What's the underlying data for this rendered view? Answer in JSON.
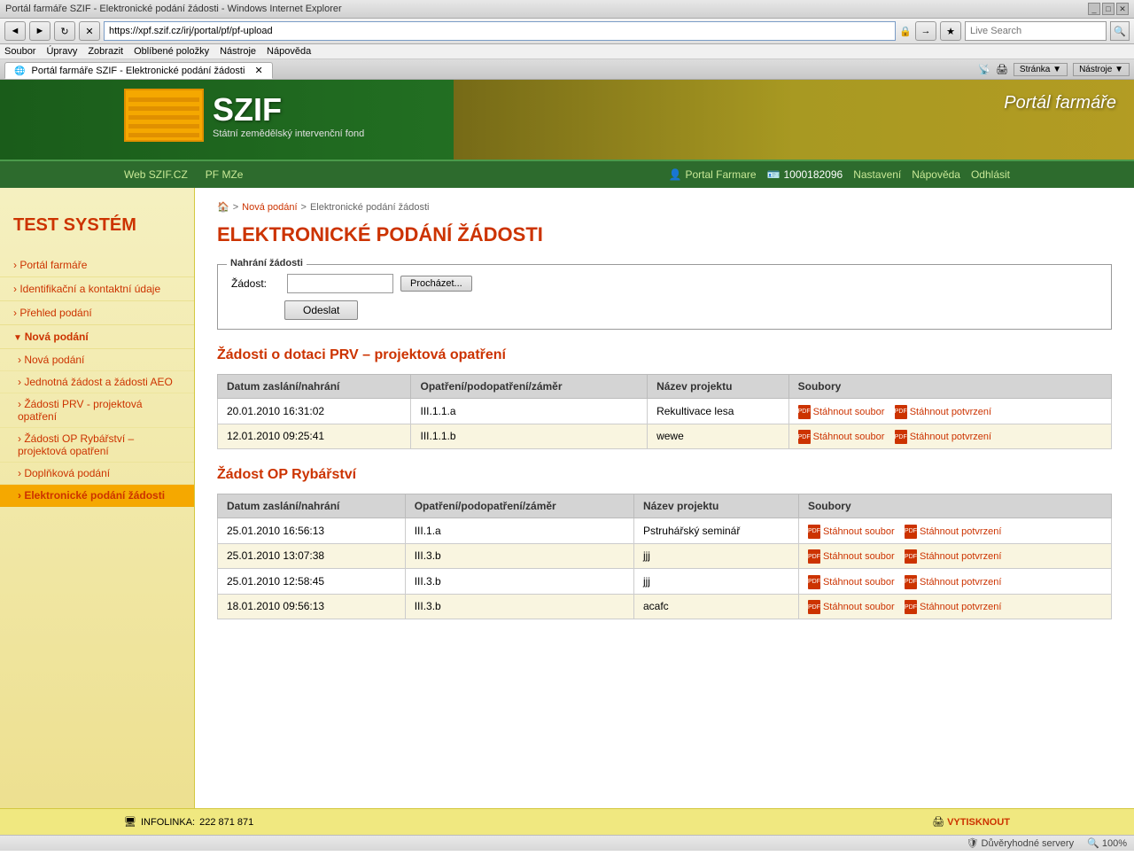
{
  "browser": {
    "title": "Portál farmáře SZIF - Elektronické podání žádosti - Windows Internet Explorer",
    "address": "https://xpf.szif.cz/irj/portal/pf/pf-upload",
    "search_placeholder": "Live Search",
    "tab_label": "Portál farmáře SZIF - Elektronické podání žádosti",
    "search_label": "Search",
    "nav_back": "◄",
    "nav_forward": "►",
    "nav_refresh": "↻",
    "nav_stop": "✕",
    "menu": {
      "soubor": "Soubor",
      "upravy": "Úpravy",
      "zobrazit": "Zobrazit",
      "oblibene": "Oblíbené položky",
      "nastroje": "Nástroje",
      "napoveda": "Nápověda"
    },
    "secondary_toolbar": {
      "stranka": "Stránka",
      "nastroje": "Nástroje"
    },
    "statusbar": {
      "status": "Důvěryhodné servery",
      "zoom": "100%"
    }
  },
  "header": {
    "logo_text": "SZIF",
    "subtitle": "Státní zemědělský intervenční fond",
    "portal_label": "Portál farmáře",
    "nav": {
      "web_szif": "Web SZIF.CZ",
      "pf_mze": "PF MZe",
      "portal_farmare": "Portal Farmare",
      "user_id": "1000182096",
      "nastaveni": "Nastavení",
      "napoveda": "Nápověda",
      "odhlasit": "Odhlásit"
    }
  },
  "sidebar": {
    "title": "TEST SYSTÉM",
    "items": [
      {
        "label": "Portál farmáře",
        "id": "portal-farmare"
      },
      {
        "label": "Identifikační a kontaktní údaje",
        "id": "identifikacni"
      },
      {
        "label": "Přehled podání",
        "id": "prehled-podani"
      }
    ],
    "section": "Nová podání",
    "sub_items": [
      {
        "label": "Nová podání",
        "id": "nova-podani",
        "active": false
      },
      {
        "label": "Jednotná žádost a žádosti AEO",
        "id": "jednotna-zadost",
        "active": false
      },
      {
        "label": "Žádosti PRV - projektová opatření",
        "id": "zadosti-prv",
        "active": false
      },
      {
        "label": "Žádosti OP Rybářství – projektová opatření",
        "id": "zadosti-op",
        "active": false
      },
      {
        "label": "Doplňková podání",
        "id": "doplnkova-podani",
        "active": false
      },
      {
        "label": "Elektronické podání žádosti",
        "id": "elektronicke-podani",
        "active": true
      }
    ]
  },
  "breadcrumb": {
    "home_icon": "🏠",
    "nova_podani": "Nová podání",
    "current": "Elektronické podání žádosti"
  },
  "content": {
    "page_title": "ELEKTRONICKÉ PODÁNÍ ŽÁDOSTI",
    "upload": {
      "legend": "Nahrání žádosti",
      "label": "Žádost:",
      "browse_btn": "Procházet...",
      "submit_btn": "Odeslat"
    },
    "prv_section": {
      "heading": "Žádosti o dotaci PRV – projektová opatření",
      "columns": [
        "Datum zaslání/nahrání",
        "Opatření/podopatření/záměr",
        "Název projektu",
        "Soubory"
      ],
      "rows": [
        {
          "datum": "20.01.2010 16:31:02",
          "opatreni": "III.1.1.a",
          "projekt": "Rekultivace lesa",
          "soubor_link": "Stáhnout soubor",
          "potvrzeni_link": "Stáhnout potvrzení"
        },
        {
          "datum": "12.01.2010 09:25:41",
          "opatreni": "III.1.1.b",
          "projekt": "wewe",
          "soubor_link": "Stáhnout soubor",
          "potvrzeni_link": "Stáhnout potvrzení"
        }
      ]
    },
    "rybarstvi_section": {
      "heading": "Žádost OP Rybářství",
      "columns": [
        "Datum zaslání/nahrání",
        "Opatření/podopatření/záměr",
        "Název projektu",
        "Soubory"
      ],
      "rows": [
        {
          "datum": "25.01.2010 16:56:13",
          "opatreni": "III.1.a",
          "projekt": "Pstruhářský seminář",
          "soubor_link": "Stáhnout soubor",
          "potvrzeni_link": "Stáhnout potvrzení"
        },
        {
          "datum": "25.01.2010 13:07:38",
          "opatreni": "III.3.b",
          "projekt": "jjj",
          "soubor_link": "Stáhnout soubor",
          "potvrzeni_link": "Stáhnout potvrzení"
        },
        {
          "datum": "25.01.2010 12:58:45",
          "opatreni": "III.3.b",
          "projekt": "jjj",
          "soubor_link": "Stáhnout soubor",
          "potvrzeni_link": "Stáhnout potvrzení"
        },
        {
          "datum": "18.01.2010 09:56:13",
          "opatreni": "III.3.b",
          "projekt": "acafc",
          "soubor_link": "Stáhnout soubor",
          "potvrzeni_link": "Stáhnout potvrzení"
        }
      ]
    }
  },
  "footer": {
    "infolinka_label": "INFOLINKA:",
    "infolinka_number": "222 871 871",
    "print_label": "VYTISKNOUT"
  }
}
